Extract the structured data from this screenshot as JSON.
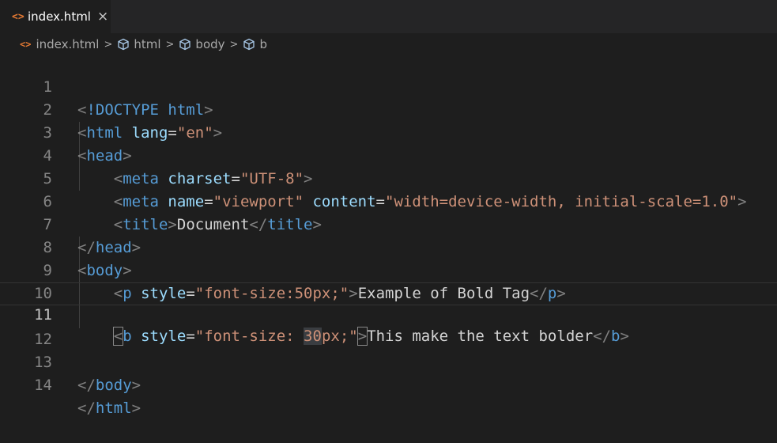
{
  "tab": {
    "filename": "index.html",
    "file_icon": "<>",
    "close_icon": "×"
  },
  "breadcrumb": {
    "file": "index.html",
    "items": [
      "html",
      "body",
      "b"
    ]
  },
  "editor": {
    "line_numbers": [
      "1",
      "2",
      "3",
      "4",
      "5",
      "6",
      "7",
      "8",
      "9",
      "10",
      "11",
      "12",
      "13",
      "14"
    ],
    "current_line": "11",
    "tokens": {
      "l1": [
        "<",
        "!DOCTYPE",
        " html",
        ">"
      ],
      "l2": [
        "<",
        "html",
        " lang",
        "=",
        "\"en\"",
        ">"
      ],
      "l3": [
        "<",
        "head",
        ">"
      ],
      "l4": [
        "<",
        "meta",
        " charset",
        "=",
        "\"UTF-8\"",
        ">"
      ],
      "l5": [
        "<",
        "meta",
        " name",
        "=",
        "\"viewport\"",
        " content",
        "=",
        "\"width=device-width, initial-scale=1.0\"",
        ">"
      ],
      "l6": [
        "<",
        "title",
        ">",
        "Document",
        "</",
        "title",
        ">"
      ],
      "l7": [
        "</",
        "head",
        ">"
      ],
      "l8": [
        "<",
        "body",
        ">"
      ],
      "l9": [
        "<",
        "p",
        " style",
        "=",
        "\"font-size:50px;\"",
        ">",
        "Example of Bold Tag",
        "</",
        "p",
        ">"
      ],
      "l11": [
        "<",
        "b",
        " style",
        "=",
        "\"font-size: ",
        "30",
        "px;\"",
        ">",
        "This make the text bolder",
        "</",
        "b",
        ">"
      ],
      "l13": [
        "</",
        "body",
        ">"
      ],
      "l14": [
        "</",
        "html",
        ">"
      ]
    }
  }
}
